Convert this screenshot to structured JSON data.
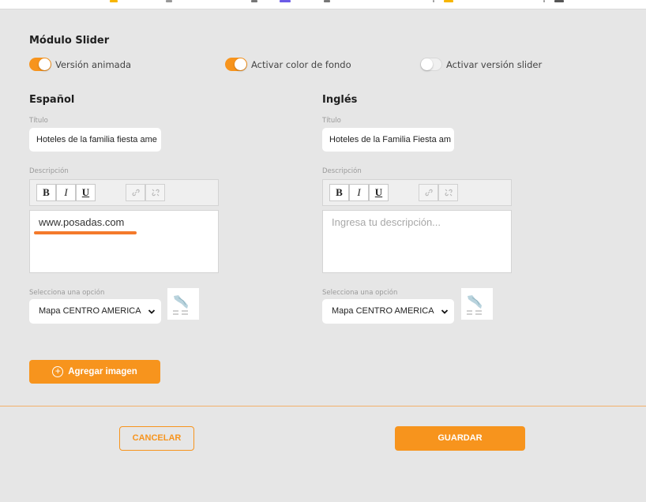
{
  "colors": {
    "accent": "#f7941d",
    "background": "#e6e6e6",
    "underline": "#f47a2b"
  },
  "module": {
    "title": "Módulo Slider",
    "toggles": [
      {
        "label": "Versión animada",
        "on": true
      },
      {
        "label": "Activar color de fondo",
        "on": true
      },
      {
        "label": "Activar versión slider",
        "on": false
      }
    ]
  },
  "spanish": {
    "heading": "Español",
    "title_label": "Título",
    "title_value": "Hoteles de la familia fiesta ame",
    "description_label": "Descripción",
    "description_value": "www.posadas.com",
    "select_label": "Selecciona una opción",
    "select_value": "Mapa CENTRO AMERICA"
  },
  "english": {
    "heading": "Inglés",
    "title_label": "Título",
    "title_value": "Hoteles de la Familia Fiesta am",
    "description_label": "Descripción",
    "description_placeholder": "Ingresa tu descripción...",
    "select_label": "Selecciona una opción",
    "select_value": "Mapa CENTRO AMERICA"
  },
  "toolbar": {
    "bold": "B",
    "italic": "I",
    "underline": "U",
    "link_icon": "link-icon",
    "unlink_icon": "unlink-icon"
  },
  "actions": {
    "add_image": "Agregar imagen",
    "cancel": "CANCELAR",
    "save": "GUARDAR"
  }
}
